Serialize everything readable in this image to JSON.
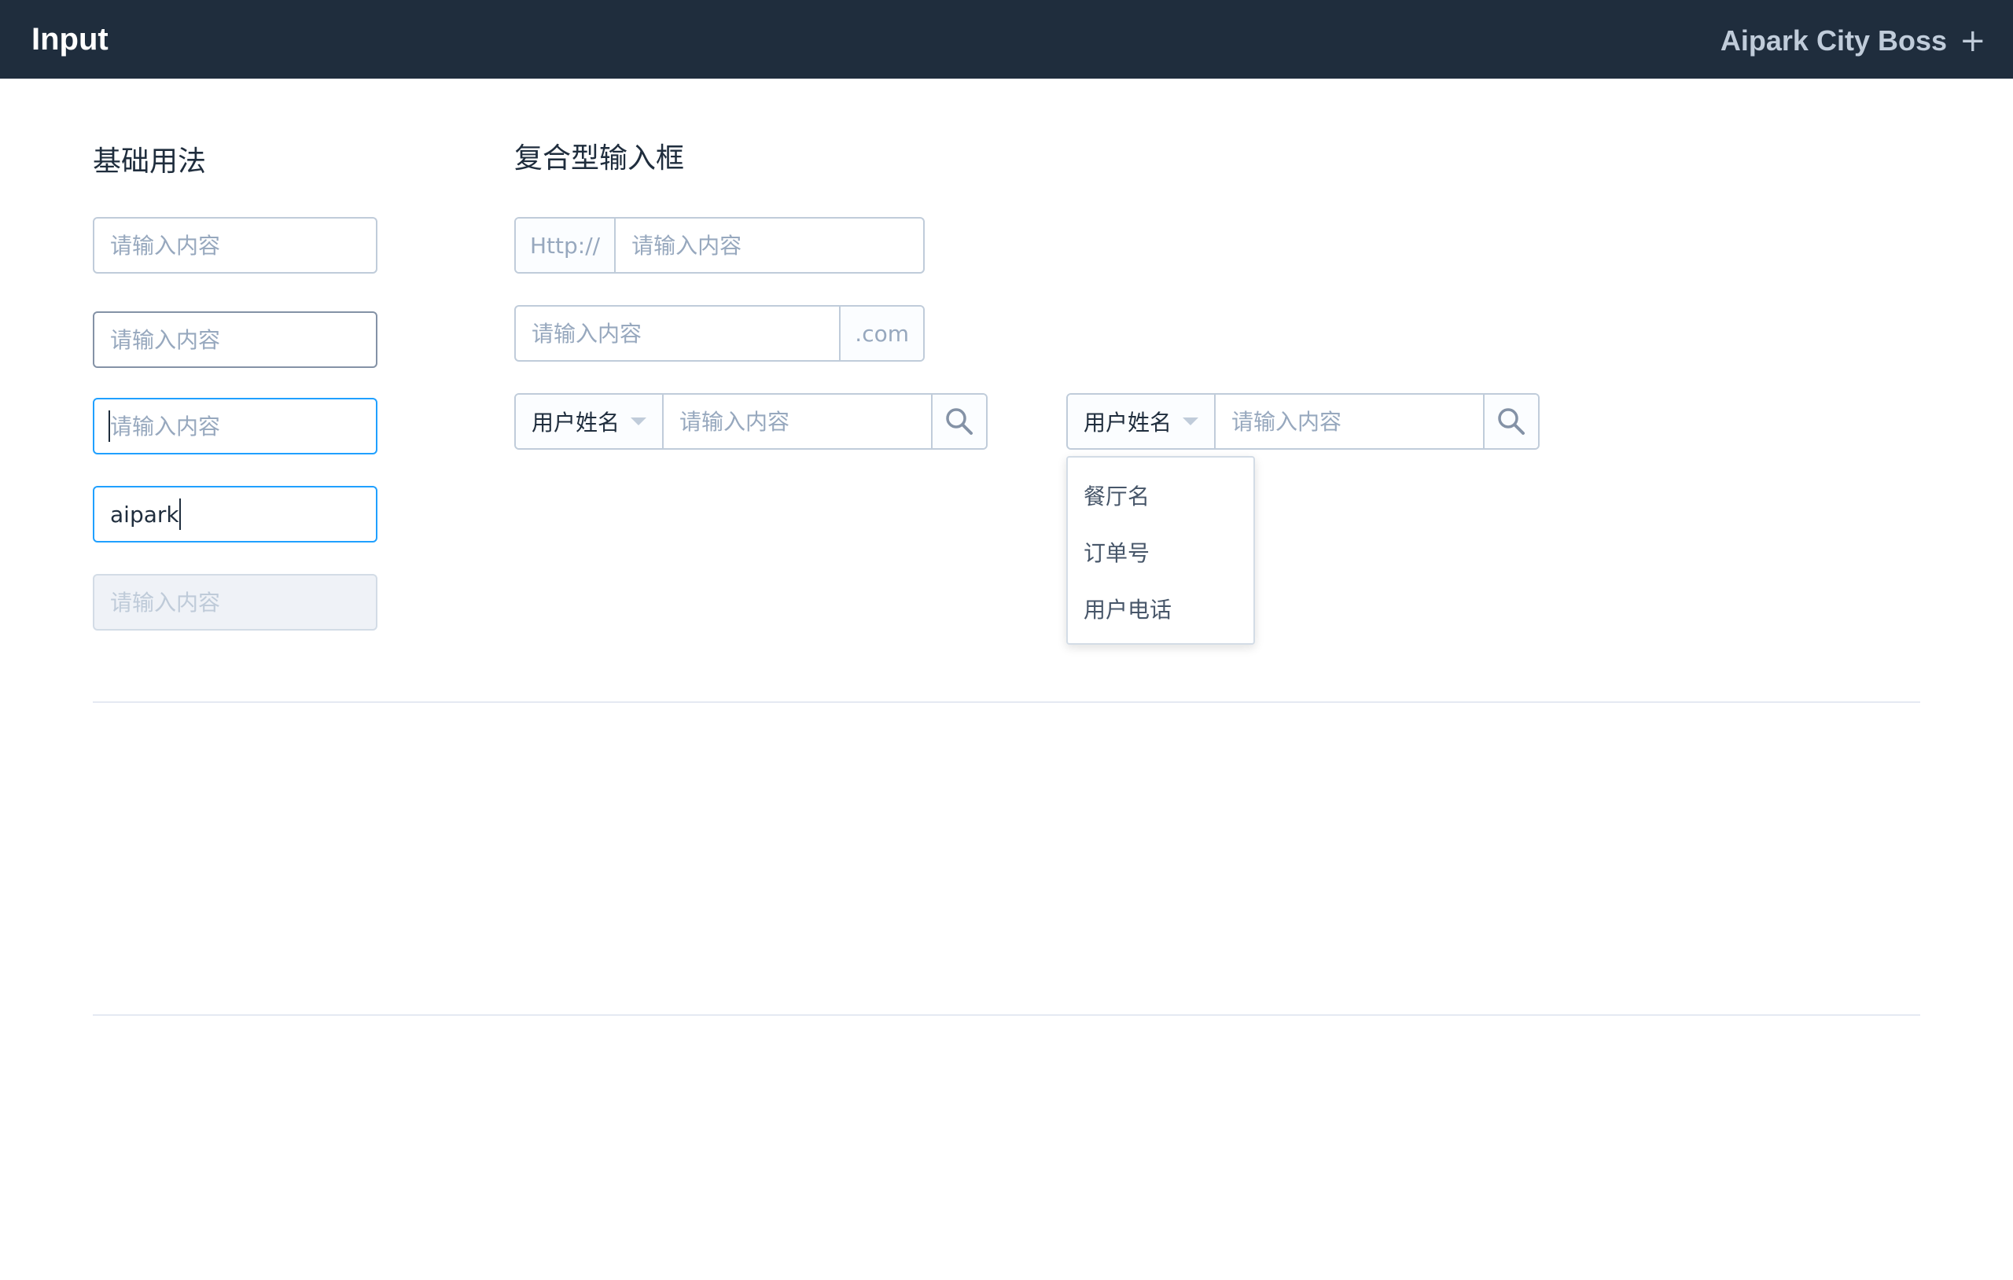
{
  "header": {
    "brand": "Input",
    "app_title": "Aipark City Boss",
    "add_icon": "plus-icon"
  },
  "basic": {
    "title": "基础用法",
    "inputs": [
      {
        "state": "default",
        "placeholder": "请输入内容",
        "value": ""
      },
      {
        "state": "hover",
        "placeholder": "请输入内容",
        "value": ""
      },
      {
        "state": "focus",
        "placeholder": "请输入内容",
        "value": ""
      },
      {
        "state": "focus",
        "placeholder": "请输入内容",
        "value": "aipark"
      },
      {
        "state": "disabled",
        "placeholder": "请输入内容",
        "value": ""
      }
    ]
  },
  "compound": {
    "title": "复合型输入框",
    "prepend_input": {
      "prepend": "Http://",
      "placeholder": "请输入内容"
    },
    "append_input": {
      "append": ".com",
      "placeholder": "请输入内容"
    },
    "select_search_1": {
      "selected": "用户姓名",
      "placeholder": "请输入内容",
      "icon": "search-icon"
    },
    "select_search_2": {
      "selected": "用户姓名",
      "placeholder": "请输入内容",
      "icon": "search-icon"
    },
    "dropdown_options": [
      "餐厅名",
      "订单号",
      "用户电话"
    ]
  },
  "colors": {
    "header_bg": "#1f2d3d",
    "border": "#c0ccda",
    "focus": "#20a0ff",
    "placeholder": "#97a8be",
    "disabled_bg": "#eff2f7"
  }
}
